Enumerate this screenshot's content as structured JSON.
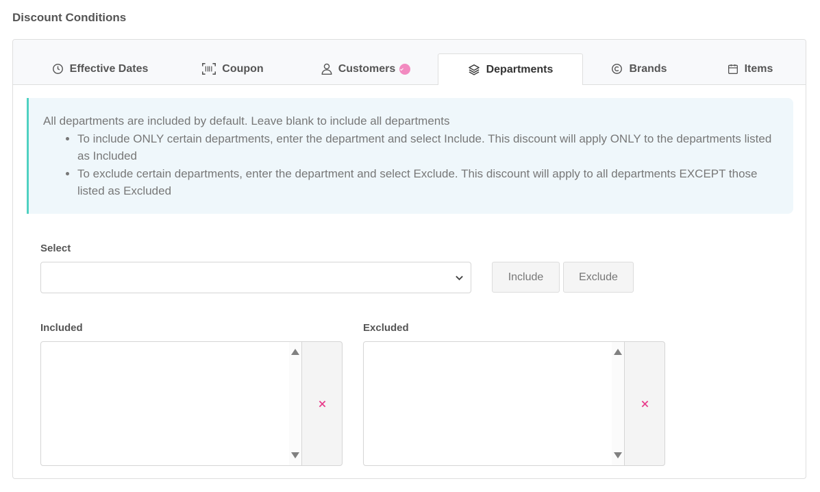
{
  "section_title": "Discount Conditions",
  "tabs": [
    {
      "label": "Effective Dates",
      "icon": "clock-icon",
      "active": false
    },
    {
      "label": "Coupon",
      "icon": "barcode-icon",
      "active": false
    },
    {
      "label": "Customers",
      "icon": "user-icon",
      "active": false,
      "badge": "check-badge"
    },
    {
      "label": "Departments",
      "icon": "layers-icon",
      "active": true
    },
    {
      "label": "Brands",
      "icon": "copyright-icon",
      "active": false
    },
    {
      "label": "Items",
      "icon": "calendar-icon",
      "active": false
    }
  ],
  "info": {
    "intro": "All departments are included by default.  Leave blank to include all departments",
    "bullets": [
      "To include ONLY certain departments, enter the department and select Include. This discount will apply ONLY to the departments listed as Included",
      "To exclude certain departments, enter the department and select Exclude. This discount will apply to all departments EXCEPT those listed as Excluded"
    ]
  },
  "select": {
    "label": "Select",
    "value": ""
  },
  "buttons": {
    "include": "Include",
    "exclude": "Exclude"
  },
  "included": {
    "label": "Included",
    "items": []
  },
  "excluded": {
    "label": "Excluded",
    "items": []
  },
  "colors": {
    "accent_teal": "#4fd1c1",
    "badge_pink": "#f28ac0",
    "remove_pink": "#e83e8c",
    "info_bg": "#eff7fb"
  }
}
